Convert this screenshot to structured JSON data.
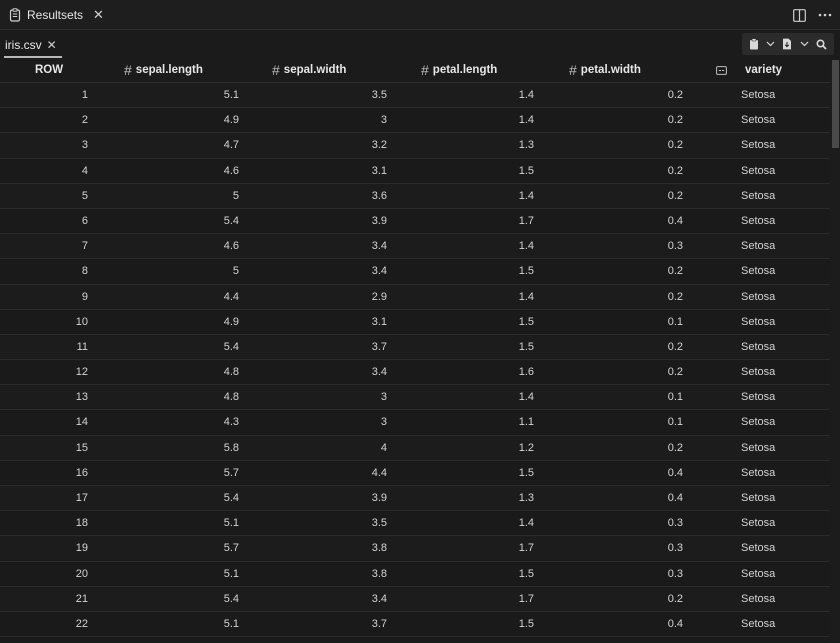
{
  "window": {
    "title": "Resultsets",
    "title_icon": "clipboard-icon",
    "actions": [
      "split-editor-icon",
      "more-icon"
    ]
  },
  "file_tab": {
    "label": "iris.csv"
  },
  "toolbar": {
    "items": [
      "clipboard-icon",
      "chevron-down-icon",
      "export-file-icon",
      "chevron-down-icon",
      "search-icon"
    ]
  },
  "table": {
    "columns": [
      {
        "key": "row",
        "label": "ROW",
        "type": "none"
      },
      {
        "key": "sepal_length",
        "label": "sepal.length",
        "type": "number"
      },
      {
        "key": "sepal_width",
        "label": "sepal.width",
        "type": "number"
      },
      {
        "key": "petal_length",
        "label": "petal.length",
        "type": "number"
      },
      {
        "key": "petal_width",
        "label": "petal.width",
        "type": "number"
      },
      {
        "key": "variety",
        "label": "variety",
        "type": "text"
      }
    ],
    "rows": [
      [
        "1",
        "5.1",
        "3.5",
        "1.4",
        "0.2",
        "Setosa"
      ],
      [
        "2",
        "4.9",
        "3",
        "1.4",
        "0.2",
        "Setosa"
      ],
      [
        "3",
        "4.7",
        "3.2",
        "1.3",
        "0.2",
        "Setosa"
      ],
      [
        "4",
        "4.6",
        "3.1",
        "1.5",
        "0.2",
        "Setosa"
      ],
      [
        "5",
        "5",
        "3.6",
        "1.4",
        "0.2",
        "Setosa"
      ],
      [
        "6",
        "5.4",
        "3.9",
        "1.7",
        "0.4",
        "Setosa"
      ],
      [
        "7",
        "4.6",
        "3.4",
        "1.4",
        "0.3",
        "Setosa"
      ],
      [
        "8",
        "5",
        "3.4",
        "1.5",
        "0.2",
        "Setosa"
      ],
      [
        "9",
        "4.4",
        "2.9",
        "1.4",
        "0.2",
        "Setosa"
      ],
      [
        "10",
        "4.9",
        "3.1",
        "1.5",
        "0.1",
        "Setosa"
      ],
      [
        "11",
        "5.4",
        "3.7",
        "1.5",
        "0.2",
        "Setosa"
      ],
      [
        "12",
        "4.8",
        "3.4",
        "1.6",
        "0.2",
        "Setosa"
      ],
      [
        "13",
        "4.8",
        "3",
        "1.4",
        "0.1",
        "Setosa"
      ],
      [
        "14",
        "4.3",
        "3",
        "1.1",
        "0.1",
        "Setosa"
      ],
      [
        "15",
        "5.8",
        "4",
        "1.2",
        "0.2",
        "Setosa"
      ],
      [
        "16",
        "5.7",
        "4.4",
        "1.5",
        "0.4",
        "Setosa"
      ],
      [
        "17",
        "5.4",
        "3.9",
        "1.3",
        "0.4",
        "Setosa"
      ],
      [
        "18",
        "5.1",
        "3.5",
        "1.4",
        "0.3",
        "Setosa"
      ],
      [
        "19",
        "5.7",
        "3.8",
        "1.7",
        "0.3",
        "Setosa"
      ],
      [
        "20",
        "5.1",
        "3.8",
        "1.5",
        "0.3",
        "Setosa"
      ],
      [
        "21",
        "5.4",
        "3.4",
        "1.7",
        "0.2",
        "Setosa"
      ],
      [
        "22",
        "5.1",
        "3.7",
        "1.5",
        "0.4",
        "Setosa"
      ]
    ]
  }
}
